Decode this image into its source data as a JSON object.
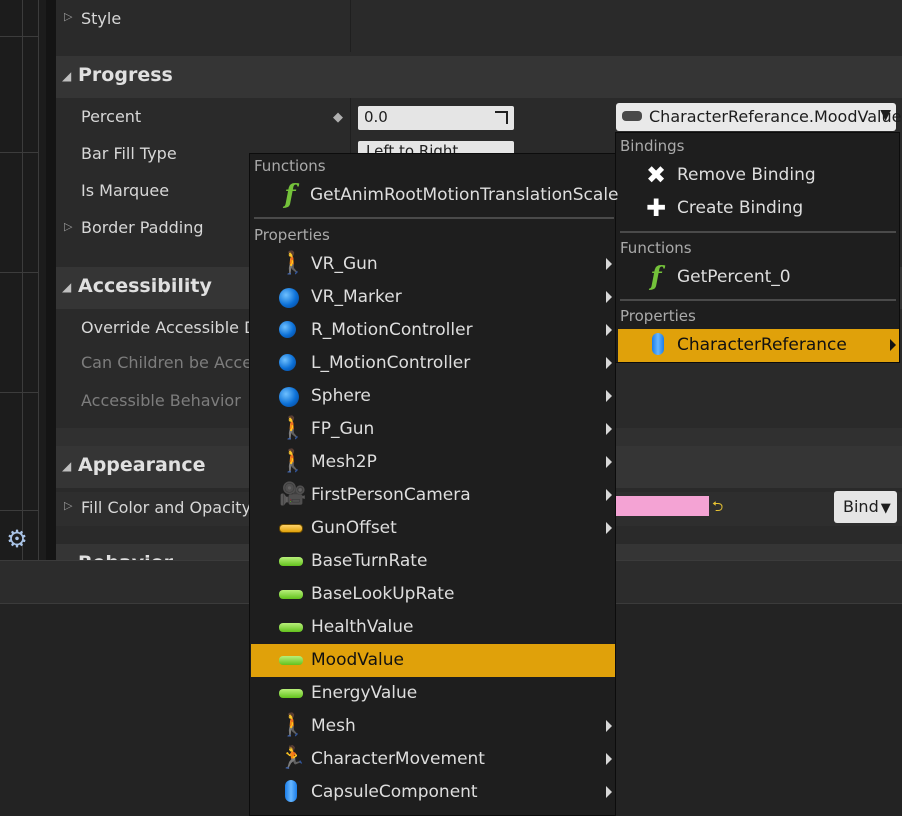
{
  "details": {
    "style_label": "Style",
    "progress": {
      "title": "Progress",
      "percent_label": "Percent",
      "percent_value": "0.0",
      "bar_fill_type_label": "Bar Fill Type",
      "bar_fill_type_value": "Left to Right",
      "is_marquee_label": "Is Marquee",
      "border_padding_label": "Border Padding",
      "binding_value": "CharacterReferance.MoodValue"
    },
    "accessibility": {
      "title": "Accessibility",
      "override_label": "Override Accessible Defaults",
      "can_children_label": "Can Children be Accessible",
      "behavior_label": "Accessible Behavior"
    },
    "appearance": {
      "title": "Appearance",
      "fill_color_label": "Fill Color and Opacity",
      "fill_color_hex": "#f4a3d4",
      "bind_label": "Bind"
    },
    "behavior": {
      "title": "Behavior"
    }
  },
  "binding_menu": {
    "bindings_header": "Bindings",
    "remove_binding": "Remove Binding",
    "create_binding": "Create Binding",
    "functions_header": "Functions",
    "get_percent": "GetPercent_0",
    "properties_header": "Properties",
    "character_ref": "CharacterReferance"
  },
  "property_menu": {
    "functions_header": "Functions",
    "function_item": "GetAnimRootMotionTranslationScale",
    "properties_header": "Properties",
    "items": [
      {
        "label": "VR_Gun",
        "icon": "skeletal-mesh-icon",
        "sub": true
      },
      {
        "label": "VR_Marker",
        "icon": "sphere-icon",
        "sub": true
      },
      {
        "label": "R_MotionController",
        "icon": "motion-controller-icon",
        "sub": true
      },
      {
        "label": "L_MotionController",
        "icon": "motion-controller-icon",
        "sub": true
      },
      {
        "label": "Sphere",
        "icon": "sphere-icon",
        "sub": true
      },
      {
        "label": "FP_Gun",
        "icon": "skeletal-mesh-icon",
        "sub": true
      },
      {
        "label": "Mesh2P",
        "icon": "skeletal-mesh-icon",
        "sub": true
      },
      {
        "label": "FirstPersonCamera",
        "icon": "camera-icon",
        "sub": true
      },
      {
        "label": "GunOffset",
        "icon": "vector-variable-icon",
        "sub": true
      },
      {
        "label": "BaseTurnRate",
        "icon": "float-variable-icon",
        "sub": false
      },
      {
        "label": "BaseLookUpRate",
        "icon": "float-variable-icon",
        "sub": false
      },
      {
        "label": "HealthValue",
        "icon": "float-variable-icon",
        "sub": false
      },
      {
        "label": "MoodValue",
        "icon": "float-variable-icon",
        "sub": false,
        "selected": true
      },
      {
        "label": "EnergyValue",
        "icon": "float-variable-icon",
        "sub": false
      },
      {
        "label": "Mesh",
        "icon": "skeletal-mesh-icon",
        "sub": true
      },
      {
        "label": "CharacterMovement",
        "icon": "character-movement-icon",
        "sub": true
      },
      {
        "label": "CapsuleComponent",
        "icon": "capsule-icon",
        "sub": true
      }
    ]
  },
  "colors": {
    "selection": "#e0a10a",
    "float_variable": "#63c21d",
    "function": "#74c23a"
  }
}
